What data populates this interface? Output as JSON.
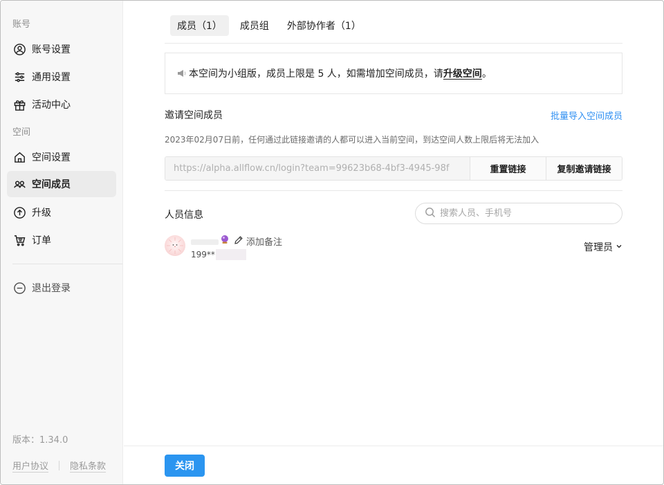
{
  "sidebar": {
    "account_label": "账号",
    "space_label": "空间",
    "items": [
      {
        "label": "账号设置",
        "icon": "user-circle-icon"
      },
      {
        "label": "通用设置",
        "icon": "sliders-icon"
      },
      {
        "label": "活动中心",
        "icon": "gift-icon"
      },
      {
        "label": "空间设置",
        "icon": "home-icon"
      },
      {
        "label": "空间成员",
        "icon": "members-icon"
      },
      {
        "label": "升级",
        "icon": "upgrade-icon"
      },
      {
        "label": "订单",
        "icon": "cart-icon"
      }
    ],
    "logout_label": "退出登录",
    "version": "版本：1.34.0",
    "user_agreement": "用户协议",
    "privacy_policy": "隐私条款"
  },
  "tabs": [
    {
      "label": "成员（1）"
    },
    {
      "label": "成员组"
    },
    {
      "label": "外部协作者（1）"
    }
  ],
  "notice": {
    "text": "本空间为小组版，成员上限是 5 人，如需增加空间成员，请",
    "link": "升级空间",
    "end": "。"
  },
  "invite": {
    "title": "邀请空间成员",
    "bulk_import": "批量导入空间成员",
    "description": "2023年02月07日前，任何通过此链接邀请的人都可以进入当前空间，到达空间人数上限后将无法加入",
    "link_value": "https://alpha.allflow.cn/login?team=99623b68-4bf3-4945-98f",
    "reset_button": "重置链接",
    "copy_button": "复制邀请链接"
  },
  "people": {
    "title": "人员信息",
    "search_placeholder": "搜索人员、手机号",
    "members": [
      {
        "add_note": "添加备注",
        "phone": "199**",
        "role": "管理员"
      }
    ]
  },
  "footer": {
    "close_button": "关闭"
  },
  "colors": {
    "accent": "#2b95f0",
    "link": "#2f8ff2"
  }
}
